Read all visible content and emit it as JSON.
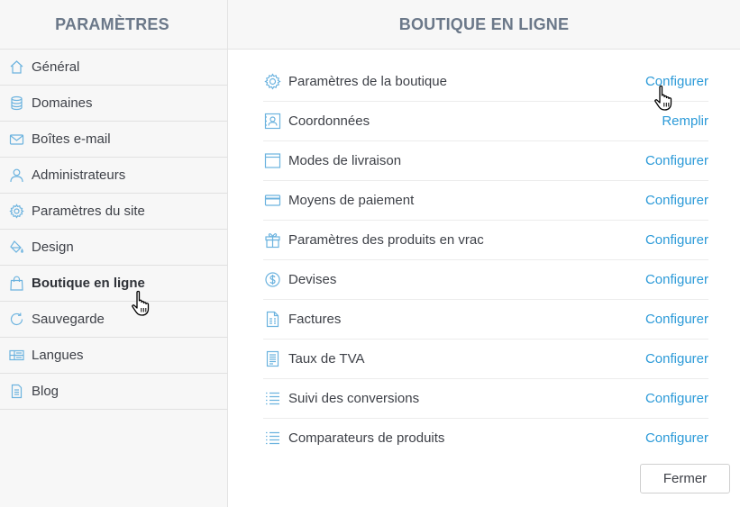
{
  "sidebar": {
    "title": "PARAMÈTRES",
    "items": [
      {
        "label": "Général",
        "icon": "home-icon"
      },
      {
        "label": "Domaines",
        "icon": "database-icon"
      },
      {
        "label": "Boîtes e-mail",
        "icon": "envelope-icon"
      },
      {
        "label": "Administrateurs",
        "icon": "user-icon"
      },
      {
        "label": "Paramètres du site",
        "icon": "gear-icon"
      },
      {
        "label": "Design",
        "icon": "paint-bucket-icon"
      },
      {
        "label": "Boutique en ligne",
        "icon": "shopping-bag-icon",
        "active": true
      },
      {
        "label": "Sauvegarde",
        "icon": "refresh-icon"
      },
      {
        "label": "Langues",
        "icon": "flags-icon"
      },
      {
        "label": "Blog",
        "icon": "document-icon"
      }
    ]
  },
  "main": {
    "title": "BOUTIQUE EN LIGNE",
    "rows": [
      {
        "label": "Paramètres de la boutique",
        "action": "Configurer",
        "icon": "gear-icon"
      },
      {
        "label": "Coordonnées",
        "action": "Remplir",
        "icon": "contact-card-icon"
      },
      {
        "label": "Modes de livraison",
        "action": "Configurer",
        "icon": "box-icon"
      },
      {
        "label": "Moyens de paiement",
        "action": "Configurer",
        "icon": "credit-card-icon"
      },
      {
        "label": "Paramètres des produits en vrac",
        "action": "Configurer",
        "icon": "gift-icon"
      },
      {
        "label": "Devises",
        "action": "Configurer",
        "icon": "dollar-coin-icon"
      },
      {
        "label": "Factures",
        "action": "Configurer",
        "icon": "invoice-icon"
      },
      {
        "label": "Taux de TVA",
        "action": "Configurer",
        "icon": "tax-document-icon"
      },
      {
        "label": "Suivi des conversions",
        "action": "Configurer",
        "icon": "list-icon"
      },
      {
        "label": "Comparateurs de produits",
        "action": "Configurer",
        "icon": "list-icon"
      }
    ],
    "close_label": "Fermer"
  },
  "colors": {
    "accent": "#2b9ad8",
    "header_text": "#6b7889",
    "icon": "#6cb3df",
    "sidebar_bg": "#f7f7f7"
  }
}
